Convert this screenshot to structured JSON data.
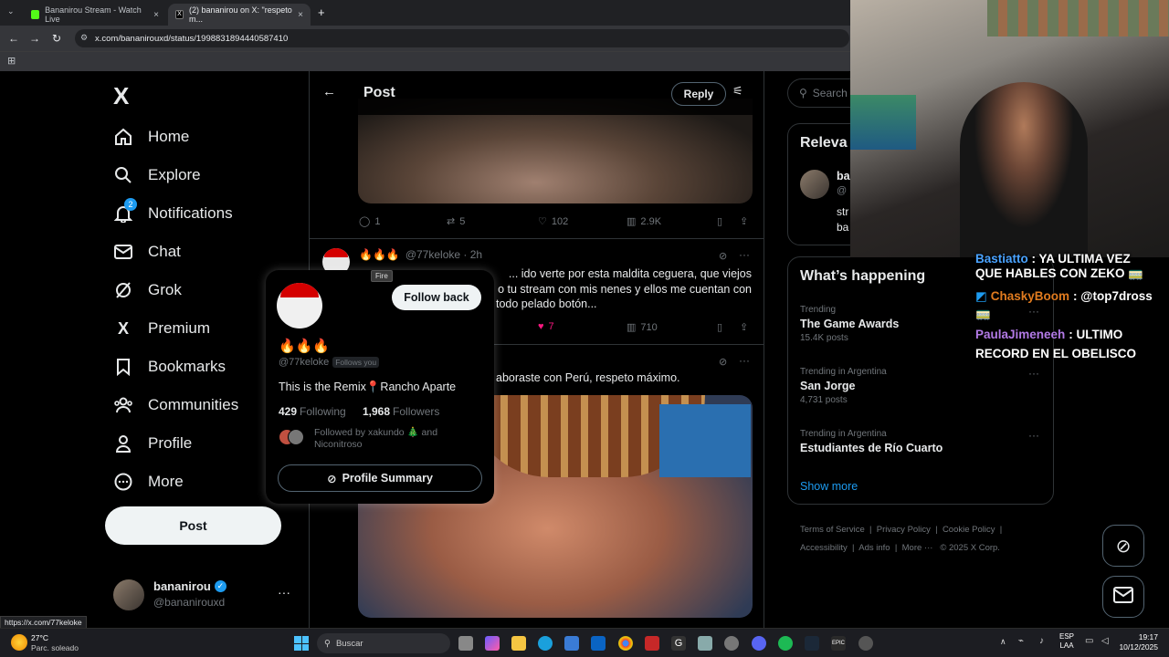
{
  "browser": {
    "tabs": [
      {
        "title": "Bananirou Stream - Watch Live",
        "close": "×"
      },
      {
        "title": "(2) bananirou on X: \"respeto m...",
        "close": "×"
      }
    ],
    "new_tab": "+",
    "url": "x.com/bananirouxd/status/1998831894440587410"
  },
  "sidebar": {
    "logo": "X",
    "items": [
      {
        "label": "Home",
        "icon": "home-icon"
      },
      {
        "label": "Explore",
        "icon": "search-icon"
      },
      {
        "label": "Notifications",
        "icon": "bell-icon",
        "badge": "2"
      },
      {
        "label": "Chat",
        "icon": "mail-icon"
      },
      {
        "label": "Grok",
        "icon": "grok-icon"
      },
      {
        "label": "Premium",
        "icon": "x-icon"
      },
      {
        "label": "Bookmarks",
        "icon": "bookmark-icon"
      },
      {
        "label": "Communities",
        "icon": "people-icon"
      },
      {
        "label": "Profile",
        "icon": "person-icon"
      },
      {
        "label": "More",
        "icon": "more-icon"
      }
    ],
    "post_label": "Post",
    "account": {
      "name": "bananirou",
      "handle": "@bananirouxd"
    }
  },
  "header": {
    "title": "Post",
    "reply_label": "Reply"
  },
  "tweet1": {
    "replies": "1",
    "retweets": "5",
    "likes": "102",
    "views": "2.9K"
  },
  "tweet2": {
    "display_name": "🔥🔥🔥",
    "meta": "@77keloke · 2h",
    "text_line1": "... ido verte por esta maldita ceguera, que viejos",
    "text_line2": "o tu stream con mis nenes y ellos me cuentan con",
    "text_line3": "todo pelado botón...",
    "likes": "7",
    "views": "710"
  },
  "tweet3": {
    "text": "aboraste con Perú, respeto máximo."
  },
  "tooltip": "Fire",
  "hovercard": {
    "follow_back": "Follow back",
    "name": "🔥🔥🔥",
    "handle": "@77keloke",
    "follows_you": "Follows you",
    "bio": "This is the Remix📍Rancho Aparte",
    "following_count": "429",
    "following_label": "Following",
    "followers_count": "1,968",
    "followers_label": "Followers",
    "followed_by": "Followed by xakundo 🎄 and",
    "followed_by2": "Niconitroso",
    "summary_label": "Profile Summary"
  },
  "right": {
    "search_placeholder": "Search",
    "relevant_title": "Releva",
    "rel_name": "ba",
    "rel_handle": "@",
    "rel_text1": "str",
    "rel_text2": "ba",
    "whats_happening": "What’s happening",
    "trends": [
      {
        "context": "Trending",
        "name": "The Game Awards",
        "posts": "15.4K posts"
      },
      {
        "context": "Trending in Argentina",
        "name": "San Jorge",
        "posts": "4,731 posts"
      },
      {
        "context": "Trending in Argentina",
        "name": "Estudiantes de Río Cuarto",
        "posts": ""
      }
    ],
    "show_more": "Show more",
    "footer": [
      "Terms of Service",
      "Privacy Policy",
      "Cookie Policy",
      "Accessibility",
      "Ads info",
      "More ···",
      "© 2025 X Corp."
    ]
  },
  "chat_overlay": {
    "line1a": "Bastiatto",
    "line1b": ": YA ULTIMA VEZ",
    "line1c": "QUE HABLES CON ZEKO 🚃",
    "line2name": "ChaskyBoom",
    "line2text": ": @top7dross",
    "line2c": "🚃",
    "line3name": "PaulaJimeneeh",
    "line3text": ": ULTIMO",
    "line3c": "RECORD EN EL OBELISCO",
    "colors": {
      "chasky": "#e07b1f",
      "paula": "#b27ae6"
    }
  },
  "status_url": "https://x.com/77keloke",
  "taskbar": {
    "weather_temp": "27°C",
    "weather_desc": "Parc. soleado",
    "search": "Buscar",
    "lang1": "ESP",
    "lang2": "LAA",
    "time": "19:17",
    "date": "10/12/2025"
  }
}
